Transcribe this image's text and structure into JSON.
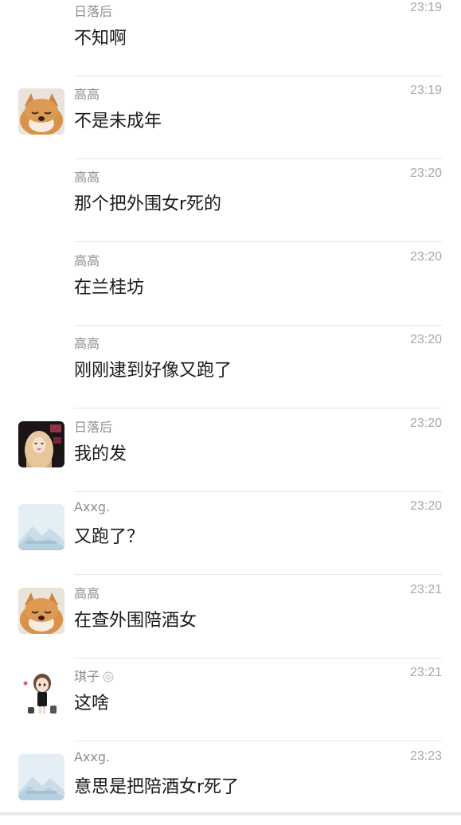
{
  "messages": [
    {
      "sender": "日落后",
      "time": "23:19",
      "text": "不知啊",
      "avatar": "none"
    },
    {
      "sender": "高高",
      "time": "23:19",
      "text": "不是未成年",
      "avatar": "shiba-inu-avatar"
    },
    {
      "sender": "高高",
      "time": "23:20",
      "text": "那个把外围女r死的",
      "avatar": "none"
    },
    {
      "sender": "高高",
      "time": "23:20",
      "text": "在兰桂坊",
      "avatar": "none"
    },
    {
      "sender": "高高",
      "time": "23:20",
      "text": "刚刚逮到好像又跑了",
      "avatar": "none"
    },
    {
      "sender": "日落后",
      "time": "23:20",
      "text": "我的发",
      "avatar": "portrait-photo-avatar"
    },
    {
      "sender": "Axxg.",
      "time": "23:20",
      "text": "又跑了？",
      "avatar": "landscape-placeholder-avatar"
    },
    {
      "sender": "高高",
      "time": "23:21",
      "text": "在查外围陪酒女",
      "avatar": "shiba-inu-avatar"
    },
    {
      "sender": "琪子",
      "time": "23:21",
      "text": "这啥",
      "avatar": "cartoon-girl-avatar",
      "badge": "flower-badge-icon"
    },
    {
      "sender": "Axxg.",
      "time": "23:23",
      "text": "意思是把陪酒女r死了",
      "avatar": "landscape-placeholder-avatar"
    }
  ],
  "colors": {
    "name": "#8f8f8f",
    "time": "#a8a8a8",
    "text": "#1a1a1a",
    "divider": "#e6e6e6"
  }
}
